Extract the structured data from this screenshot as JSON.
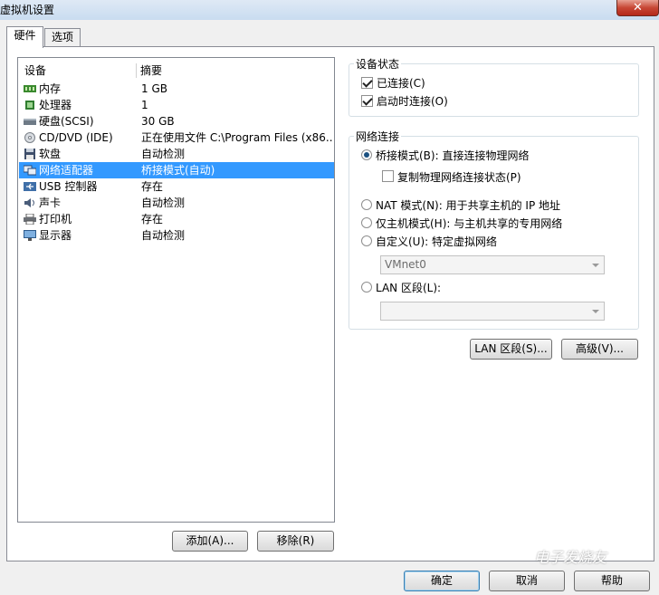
{
  "window": {
    "title": "虚拟机设置",
    "close_glyph": "✕"
  },
  "tabs": [
    {
      "label": "硬件"
    },
    {
      "label": "选项"
    }
  ],
  "device_list": {
    "columns": {
      "device": "设备",
      "summary": "摘要"
    },
    "rows": [
      {
        "name": "内存",
        "summary": "1 GB",
        "icon": "memory-icon"
      },
      {
        "name": "处理器",
        "summary": "1",
        "icon": "processor-icon"
      },
      {
        "name": "硬盘(SCSI)",
        "summary": "30 GB",
        "icon": "hard-disk-icon"
      },
      {
        "name": "CD/DVD (IDE)",
        "summary": "正在使用文件 C:\\Program Files (x86...",
        "icon": "cd-dvd-icon"
      },
      {
        "name": "软盘",
        "summary": "自动检测",
        "icon": "floppy-icon"
      },
      {
        "name": "网络适配器",
        "summary": "桥接模式(自动)",
        "icon": "network-adapter-icon"
      },
      {
        "name": "USB 控制器",
        "summary": "存在",
        "icon": "usb-icon"
      },
      {
        "name": "声卡",
        "summary": "自动检测",
        "icon": "sound-card-icon"
      },
      {
        "name": "打印机",
        "summary": "存在",
        "icon": "printer-icon"
      },
      {
        "name": "显示器",
        "summary": "自动检测",
        "icon": "display-icon"
      }
    ],
    "selected_index": 5
  },
  "list_buttons": {
    "add": "添加(A)...",
    "remove": "移除(R)"
  },
  "device_status": {
    "title": "设备状态",
    "connected": {
      "label": "已连接(C)",
      "checked": true
    },
    "connect_at_power_on": {
      "label": "启动时连接(O)",
      "checked": true
    }
  },
  "network": {
    "title": "网络连接",
    "bridged": {
      "label": "桥接模式(B): 直接连接物理网络",
      "selected": true
    },
    "replicate": {
      "label": "复制物理网络连接状态(P)",
      "checked": false
    },
    "nat": {
      "label": "NAT 模式(N): 用于共享主机的 IP 地址",
      "selected": false
    },
    "host_only": {
      "label": "仅主机模式(H): 与主机共享的专用网络",
      "selected": false
    },
    "custom": {
      "label": "自定义(U): 特定虚拟网络",
      "selected": false
    },
    "vmnet_select": {
      "value": "VMnet0"
    },
    "lan_segment": {
      "label": "LAN 区段(L):",
      "selected": false
    },
    "lan_select": {
      "value": ""
    }
  },
  "action_buttons": {
    "lan_segments": "LAN 区段(S)...",
    "advanced": "高级(V)..."
  },
  "dialog_buttons": {
    "ok": "确定",
    "cancel": "取消",
    "help": "帮助"
  },
  "watermark": "电子发烧友"
}
